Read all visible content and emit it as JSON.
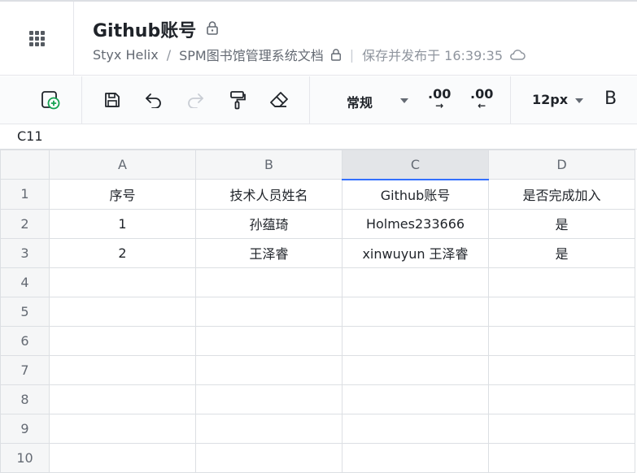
{
  "header": {
    "doc_title": "Github账号",
    "breadcrumb": {
      "owner": "Styx Helix",
      "separator": "/",
      "folder": "SPM图书馆管理系统文档",
      "save_status": "保存并发布于 16:39:35"
    },
    "icons": [
      "app-menu-icon",
      "lock-icon",
      "cloud-icon"
    ]
  },
  "toolbar": {
    "number_format": "常规",
    "font_size": "12px",
    "bold_label": "B",
    "increase_decimal_label": ".00",
    "decrease_decimal_label": ".00",
    "icons": [
      "add-sheet-icon",
      "save-icon",
      "undo-icon",
      "redo-icon",
      "format-painter-icon",
      "eraser-icon"
    ]
  },
  "cell_ref": "C11",
  "sheet": {
    "columns": [
      "A",
      "B",
      "C",
      "D"
    ],
    "row_numbers": [
      "1",
      "2",
      "3",
      "4",
      "5",
      "6",
      "7",
      "8",
      "9",
      "10"
    ],
    "rows": [
      [
        "序号",
        "技术人员姓名",
        "Github账号",
        "是否完成加入"
      ],
      [
        "1",
        "孙蕴琦",
        "Holmes233666",
        "是"
      ],
      [
        "2",
        "王泽睿",
        "xinwuyun 王泽睿",
        "是"
      ],
      [
        "",
        "",
        "",
        ""
      ],
      [
        "",
        "",
        "",
        ""
      ],
      [
        "",
        "",
        "",
        ""
      ],
      [
        "",
        "",
        "",
        ""
      ],
      [
        "",
        "",
        "",
        ""
      ],
      [
        "",
        "",
        "",
        ""
      ],
      [
        "",
        "",
        "",
        ""
      ]
    ],
    "active_column": "C"
  },
  "colors": {
    "accent": "#3370ff",
    "header_bg": "#f5f6f7",
    "text": "#1f2329",
    "muted": "#646a73"
  }
}
